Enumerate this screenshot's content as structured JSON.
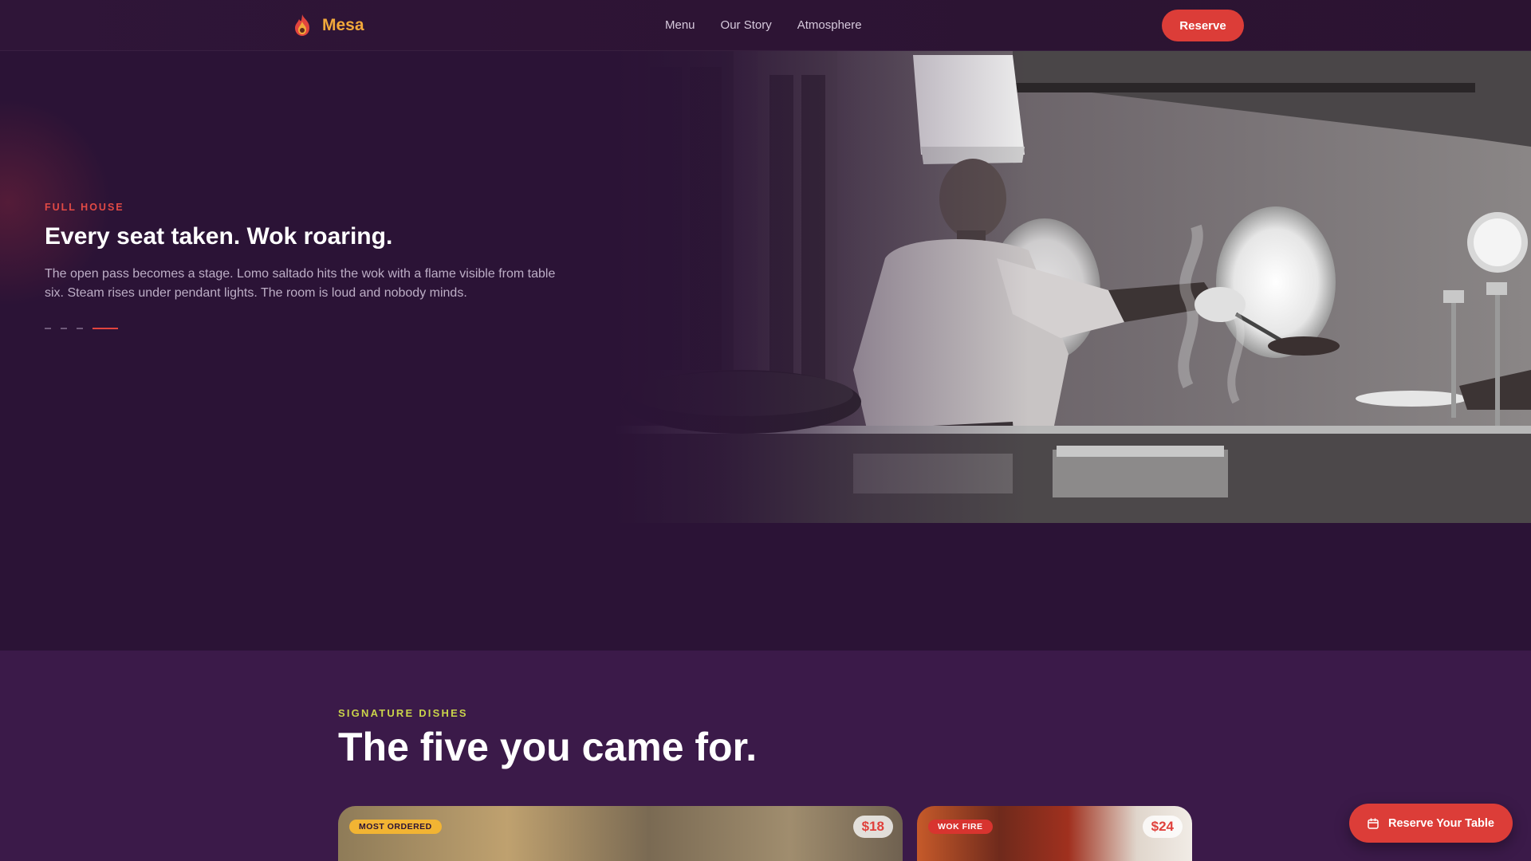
{
  "nav": {
    "brand": "Mesa",
    "links": [
      "Menu",
      "Our Story",
      "Atmosphere"
    ],
    "reserve_label": "Reserve"
  },
  "hero": {
    "eyebrow": "FULL HOUSE",
    "title": "Every seat taken. Wok roaring.",
    "body": "The open pass becomes a stage. Lomo saltado hits the wok with a flame visible from table six. Steam rises under pendant lights. The room is loud and nobody minds.",
    "slide_count": 4,
    "active_slide": 4
  },
  "signature": {
    "eyebrow": "SIGNATURE DISHES",
    "title": "The five you came for.",
    "cards": [
      {
        "badge": "MOST ORDERED",
        "price": "$18"
      },
      {
        "badge": "WOK FIRE",
        "price": "$24"
      }
    ]
  },
  "floating": {
    "reserve_label": "Reserve Your Table"
  },
  "colors": {
    "background": "#2b1336",
    "accent_red": "#dc3d38",
    "brand_gold": "#f2a93b",
    "signature_yellow": "#c9d34a"
  }
}
